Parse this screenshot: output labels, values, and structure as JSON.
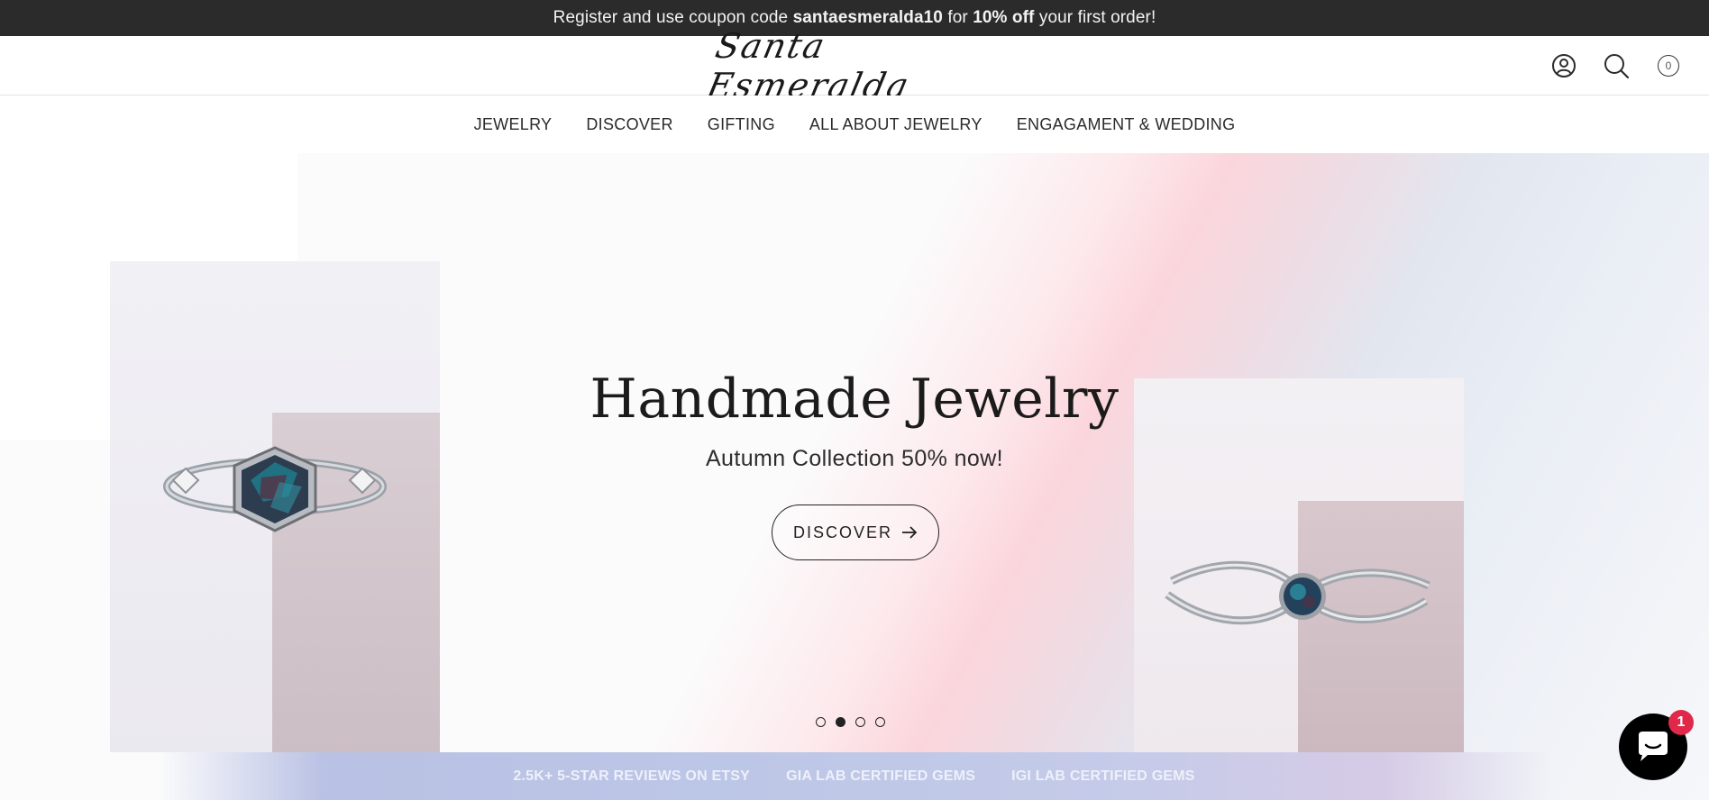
{
  "announcement": {
    "part1": "Register and use coupon code ",
    "code": "santaesmeralda10",
    "part2": " for ",
    "discount": "10% off",
    "part3": " your first order!"
  },
  "header": {
    "logo_text": "Santa Esmeralda",
    "account_icon": "account-icon",
    "search_icon": "search-icon",
    "cart_icon": "cart-icon",
    "cart_count": "0"
  },
  "nav": {
    "items": [
      "JEWELRY",
      "DISCOVER",
      "GIFTING",
      "ALL ABOUT JEWELRY",
      "ENGAGAMENT & WEDDING"
    ]
  },
  "hero": {
    "title": "Handmade Jewelry",
    "subtitle": "Autumn Collection 50% now!",
    "button_label": "DISCOVER",
    "slides_total": 4,
    "active_slide": 2
  },
  "trust_strip": {
    "items": [
      "2.5K+ 5-STAR REVIEWS ON ETSY",
      "GIA LAB CERTIFIED GEMS",
      "IGI LAB CERTIFIED GEMS"
    ]
  },
  "chat": {
    "icon": "chat-icon",
    "badge": "1"
  },
  "colors": {
    "announcement_bg": "#2b2b2b",
    "chat_badge": "#e0284a",
    "text_dark": "#222222"
  }
}
